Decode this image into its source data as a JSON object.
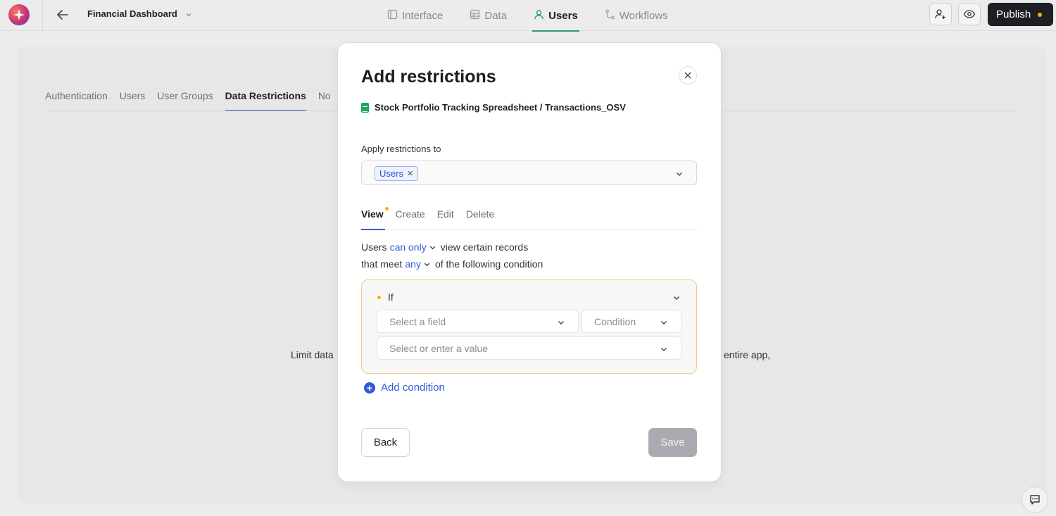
{
  "topbar": {
    "app_title": "Financial Dashboard",
    "nav": [
      {
        "label": "Interface",
        "icon": "layout-icon"
      },
      {
        "label": "Data",
        "icon": "table-icon"
      },
      {
        "label": "Users",
        "icon": "user-icon"
      },
      {
        "label": "Workflows",
        "icon": "workflow-icon"
      }
    ],
    "active_nav": "Users",
    "publish_label": "Publish"
  },
  "background": {
    "sub_tabs": [
      "Authentication",
      "Users",
      "User Groups",
      "Data Restrictions",
      "No"
    ],
    "active_sub_tab": "Data Restrictions",
    "text_left": "Limit data",
    "text_right": "entire app,"
  },
  "modal": {
    "title": "Add restrictions",
    "source": "Stock Portfolio Tracking Spreadsheet / Transactions_OSV",
    "apply_label": "Apply restrictions to",
    "chips": [
      "Users"
    ],
    "tabs": [
      "View",
      "Create",
      "Edit",
      "Delete"
    ],
    "active_tab": "View",
    "rule": {
      "subject": "Users",
      "mode": "can only",
      "action": "view certain records",
      "meet_prefix": "that meet",
      "meet_mode": "any",
      "meet_suffix": "of the following condition"
    },
    "condition": {
      "if_label": "If",
      "field_placeholder": "Select a field",
      "condition_placeholder": "Condition",
      "value_placeholder": "Select or enter a value"
    },
    "add_condition_label": "Add condition",
    "back_label": "Back",
    "save_label": "Save"
  },
  "colors": {
    "accent_blue": "#2d5bd8",
    "nav_active_green": "#2e9e6b",
    "warning_dot": "#f5b400",
    "condition_border": "#f3c78c"
  }
}
